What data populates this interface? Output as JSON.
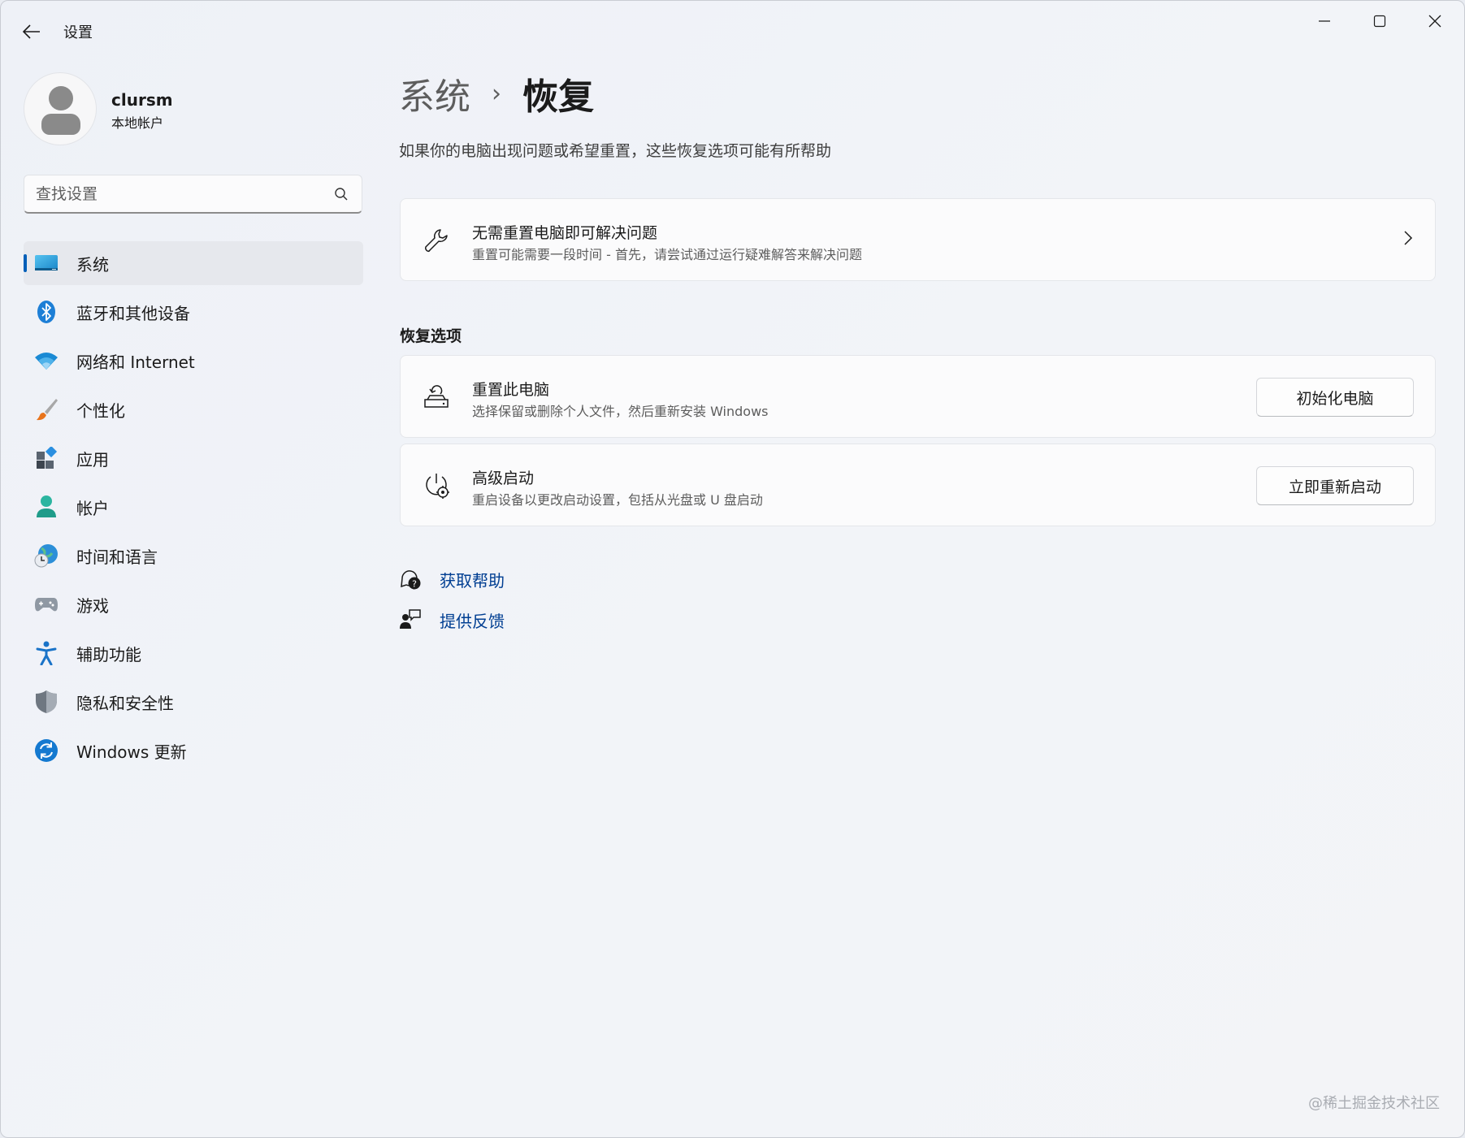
{
  "window": {
    "title": "设置",
    "controls": [
      "minimize",
      "maximize",
      "close"
    ]
  },
  "profile": {
    "name": "clursm",
    "account_type": "本地帐户"
  },
  "search": {
    "placeholder": "查找设置"
  },
  "sidebar": {
    "items": [
      {
        "label": "系统",
        "icon": "monitor-icon",
        "active": true
      },
      {
        "label": "蓝牙和其他设备",
        "icon": "bluetooth-icon",
        "active": false
      },
      {
        "label": "网络和 Internet",
        "icon": "wifi-icon",
        "active": false
      },
      {
        "label": "个性化",
        "icon": "brush-icon",
        "active": false
      },
      {
        "label": "应用",
        "icon": "apps-icon",
        "active": false
      },
      {
        "label": "帐户",
        "icon": "account-icon",
        "active": false
      },
      {
        "label": "时间和语言",
        "icon": "globe-clock-icon",
        "active": false
      },
      {
        "label": "游戏",
        "icon": "gamepad-icon",
        "active": false
      },
      {
        "label": "辅助功能",
        "icon": "accessibility-icon",
        "active": false
      },
      {
        "label": "隐私和安全性",
        "icon": "shield-icon",
        "active": false
      },
      {
        "label": "Windows 更新",
        "icon": "update-icon",
        "active": false
      }
    ]
  },
  "breadcrumb": {
    "parent": "系统",
    "separator": "›",
    "current": "恢复"
  },
  "main": {
    "description": "如果你的电脑出现问题或希望重置，这些恢复选项可能有所帮助",
    "troubleshoot_card": {
      "title": "无需重置电脑即可解决问题",
      "subtitle": "重置可能需要一段时间 - 首先，请尝试通过运行疑难解答来解决问题",
      "icon": "wrench-icon"
    },
    "section_title": "恢复选项",
    "options": [
      {
        "title": "重置此电脑",
        "subtitle": "选择保留或删除个人文件，然后重新安装 Windows",
        "button": "初始化电脑",
        "icon": "reset-pc-icon"
      },
      {
        "title": "高级启动",
        "subtitle": "重启设备以更改启动设置，包括从光盘或 U 盘启动",
        "button": "立即重新启动",
        "icon": "advanced-startup-icon"
      }
    ],
    "links": [
      {
        "label": "获取帮助",
        "icon": "help-icon"
      },
      {
        "label": "提供反馈",
        "icon": "feedback-icon"
      }
    ]
  },
  "watermark": "@稀土掘金技术社区",
  "colors": {
    "accent": "#005fb8",
    "link": "#003e92"
  }
}
